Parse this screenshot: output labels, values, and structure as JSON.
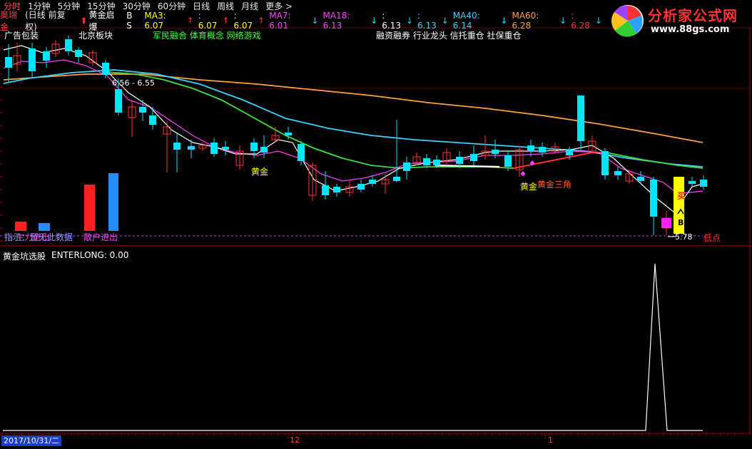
{
  "toolbar": {
    "items": [
      "分时",
      "1分钟",
      "5分钟",
      "15分钟",
      "30分钟",
      "60分钟",
      "日线",
      "周线",
      "月线",
      "更多 >"
    ]
  },
  "info": {
    "stock": "奥瑞金",
    "mode": "(日线 前复权)",
    "indicator": "黄金启爆",
    "bs": "B S",
    "ma3": "MA3: 6.07",
    "ma3b": ": 6.07",
    "ma3c": ": 6.07",
    "ma7": "MA7: 6.01",
    "ma18": "MA18: 6.13",
    "ma18b": ": 6.13",
    "ma18c": ": 6.13",
    "ma40": "MA40: 6.14",
    "ma60": "MA60: 6.28",
    "ma60b": ": 6.28"
  },
  "concepts": {
    "c1": "广告包装",
    "c2": "北京板块",
    "c3": "军民融合 体育概念 网络游戏",
    "c4": "融资融券 行业龙头 信托重仓 社保重仓"
  },
  "annotations": {
    "range": "6.56 - 6.55",
    "gold1": "黄金",
    "gold2": "黄金",
    "gold_triangle": "黄金三角",
    "low_price": "5.78",
    "low_point": "低点",
    "buy": "买",
    "b": "B",
    "main_label": "主力进出",
    "retail_label": "散户进出",
    "no_data": "指示：暂无此数据"
  },
  "lower": {
    "title": "黄金坑选股",
    "value": "ENTERLONG: 0.00"
  },
  "axis": {
    "date": "2017/10/31/二",
    "month_dec": "12",
    "month_jan": "1"
  },
  "logo": {
    "name": "分析家公式网",
    "url": "www.88gs.com"
  },
  "colors": {
    "up": "#ff3333",
    "down": "#00e5ff",
    "ma_white": "#ffffff",
    "ma_magenta": "#ff40ff",
    "ma_green": "#40e040",
    "ma_cyan": "#40d0ff",
    "ma_orange": "#ffa040",
    "yellow": "#ffff00"
  }
}
